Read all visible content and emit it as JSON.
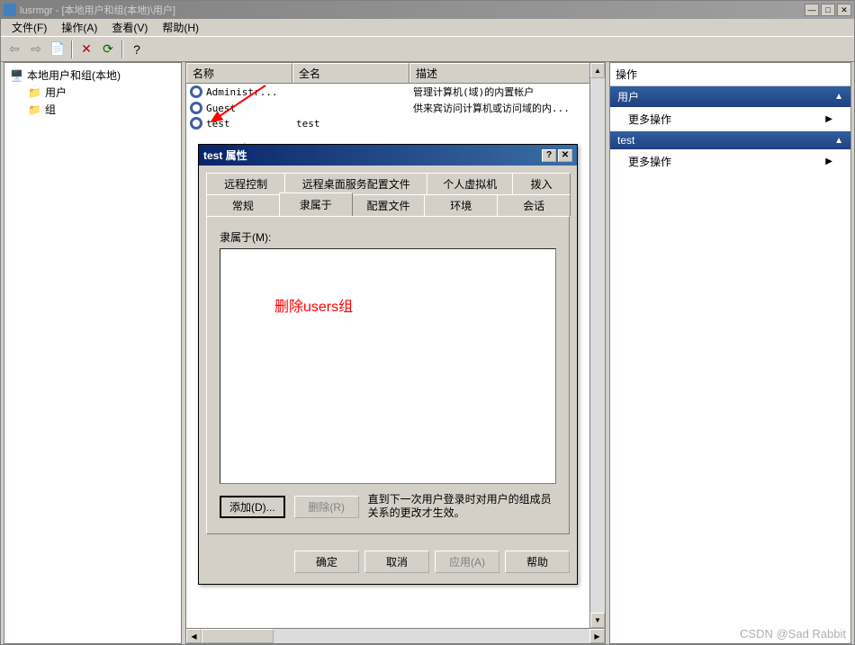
{
  "window": {
    "title": "lusrmgr - [本地用户和组(本地)\\用户]"
  },
  "menubar": {
    "file": "文件(F)",
    "action": "操作(A)",
    "view": "查看(V)",
    "help": "帮助(H)"
  },
  "tree": {
    "root": "本地用户和组(本地)",
    "users": "用户",
    "groups": "组"
  },
  "columns": {
    "name": "名称",
    "fullname": "全名",
    "desc": "描述"
  },
  "users": [
    {
      "name": "Administr...",
      "fullname": "",
      "desc": "管理计算机(域)的内置帐户"
    },
    {
      "name": "Guest",
      "fullname": "",
      "desc": "供来宾访问计算机或访问域的内..."
    },
    {
      "name": "test",
      "fullname": "test",
      "desc": ""
    }
  ],
  "actions": {
    "header": "操作",
    "section1": "用户",
    "more1": "更多操作",
    "section2": "test",
    "more2": "更多操作"
  },
  "dialog": {
    "title": "test 属性",
    "tabs_row1": [
      "远程控制",
      "远程桌面服务配置文件",
      "个人虚拟机",
      "拨入"
    ],
    "tabs_row2": [
      "常规",
      "隶属于",
      "配置文件",
      "环境",
      "会话"
    ],
    "member_label": "隶属于(M):",
    "add": "添加(D)...",
    "remove": "删除(R)",
    "note": "直到下一次用户登录时对用户的组成员关系的更改才生效。",
    "ok": "确定",
    "cancel": "取消",
    "apply": "应用(A)",
    "help": "帮助",
    "annotation": "删除users组"
  },
  "watermark": "CSDN @Sad Rabbit"
}
